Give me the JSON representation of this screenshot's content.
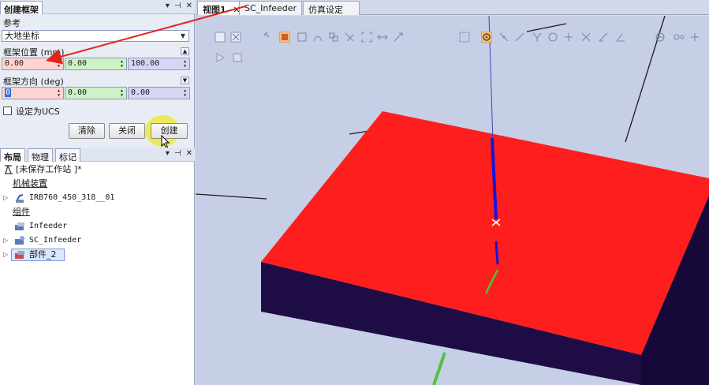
{
  "left_panel": {
    "tab_label": "创建框架",
    "reference_label": "参考",
    "reference_value": "大地坐标",
    "position_label": "框架位置 (mm)",
    "position": {
      "x": "0.00",
      "y": "0.00",
      "z": "100.00"
    },
    "orientation_label": "框架方向 (deg)",
    "orientation": {
      "x": "0",
      "y": "0.00",
      "z": "0.00"
    },
    "set_ucs_label": "设定为UCS",
    "buttons": {
      "clear": "清除",
      "close": "关闭",
      "create": "创建"
    }
  },
  "layout_panel": {
    "tabs": [
      "布局",
      "物理",
      "标记"
    ],
    "tree": {
      "station": "[未保存工作站 ]*",
      "mechanisms_header": "机械装置",
      "robot": "IRB760_450_318__01",
      "components_header": "组件",
      "infeeder": "Infeeder",
      "sc_infeeder": "SC_Infeeder",
      "part": "部件_2"
    }
  },
  "view_tabs": [
    {
      "label": "视图1",
      "closable": true
    },
    {
      "label": "SC_Infeeder",
      "closable": false
    },
    {
      "label": "仿真设定",
      "closable": false
    }
  ],
  "colors": {
    "box_top": "#ff1e1e",
    "box_side": "#1e0d45",
    "viewport_bg": "#c7cfe6",
    "z_axis": "#1515d6",
    "y_axis": "#4dc43a",
    "annotation_arrow": "#e3231b"
  }
}
